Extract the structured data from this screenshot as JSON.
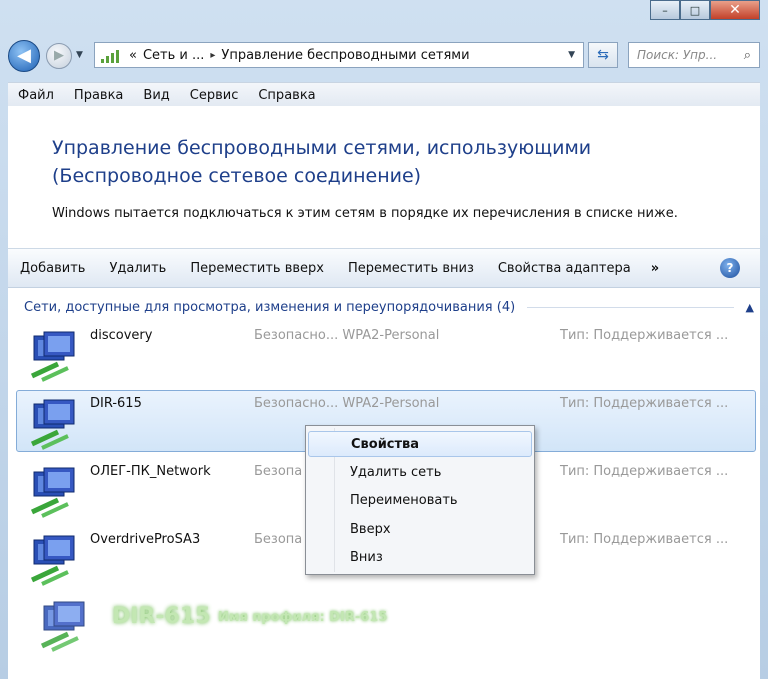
{
  "caption": {
    "min": "–",
    "max": "□",
    "close": "✕"
  },
  "nav": {
    "back": "◀",
    "forward": "▶",
    "crumb_prefix": "«",
    "crumb_1": "Сеть и ...",
    "crumb_sep": "▸",
    "crumb_2": "Управление беспроводными сетями",
    "search_placeholder": "Поиск: Упр..."
  },
  "menu": [
    "Файл",
    "Правка",
    "Вид",
    "Сервис",
    "Справка"
  ],
  "heading": "Управление беспроводными сетями, использующими (Беспроводное сетевое соединение)",
  "description": "Windows пытается подключаться к этим сетям в порядке их перечисления в списке ниже.",
  "toolbar": {
    "add": "Добавить",
    "remove": "Удалить",
    "move_up": "Переместить вверх",
    "move_down": "Переместить вниз",
    "adapter_props": "Свойства адаптера",
    "more": "»",
    "help": "?"
  },
  "group_header": "Сети, доступные для просмотра, изменения и переупорядочивания (4)",
  "networks": [
    {
      "name": "discovery",
      "security": "Безопасно... WPA2-Personal",
      "type": "Тип:  Поддерживается ..."
    },
    {
      "name": "DIR-615",
      "security": "Безопасно... WPA2-Personal",
      "type": "Тип:  Поддерживается ..."
    },
    {
      "name": "ОЛЕГ-ПК_Network",
      "security": "Безопа",
      "type": "Тип:  Поддерживается ..."
    },
    {
      "name": "OverdriveProSA3",
      "security": "Безопа",
      "type": "Тип:  Поддерживается ..."
    }
  ],
  "drag_ghost": {
    "name": "DIR-615",
    "subtitle": "Имя профиля: DIR-615"
  },
  "context_menu": [
    "Свойства",
    "Удалить сеть",
    "Переименовать",
    "Вверх",
    "Вниз"
  ],
  "colors": {
    "heading": "#1e3f8a",
    "selection": "#d2e5f8",
    "ghost_text": "#b9e3a6"
  }
}
